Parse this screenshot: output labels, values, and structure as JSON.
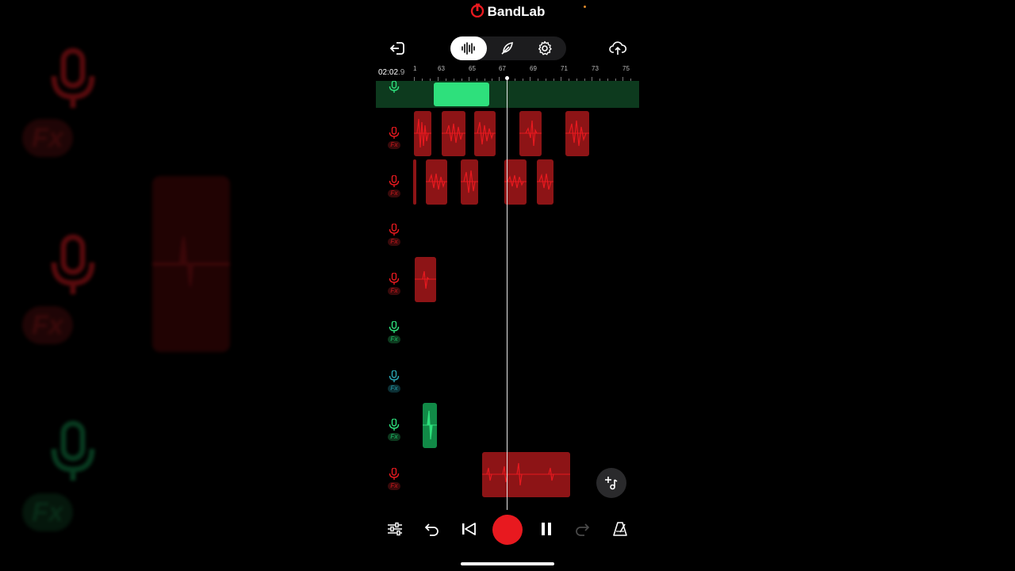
{
  "app": {
    "brand": "BandLab"
  },
  "colors": {
    "red": "#e8191f",
    "clip_red": "#8d1416",
    "green": "#2ee07c",
    "green_dark": "#0d3a1e",
    "cyan": "#2aa6b5"
  },
  "toolbar": {
    "back_icon": "exit-icon",
    "view_modes": [
      "waveform-icon",
      "feather-icon",
      "settings-gear-icon"
    ],
    "active_mode": "waveform-icon",
    "upload_icon": "cloud-upload-icon"
  },
  "timeline": {
    "timecode_main": "02:02",
    "timecode_frac": ".9",
    "ruler_labels": [
      "1",
      "63",
      "65",
      "67",
      "69",
      "71",
      "73",
      "75"
    ]
  },
  "tracks": [
    {
      "color": "green",
      "fx": false
    },
    {
      "color": "red",
      "fx": "Fx"
    },
    {
      "color": "red",
      "fx": "Fx"
    },
    {
      "color": "red",
      "fx": "Fx"
    },
    {
      "color": "red",
      "fx": "Fx"
    },
    {
      "color": "green",
      "fx": "Fx"
    },
    {
      "color": "cyan",
      "fx": "Fx"
    },
    {
      "color": "green",
      "fx": "Fx"
    },
    {
      "color": "red",
      "fx": "Fx"
    }
  ],
  "transport": {
    "icons": [
      "mixer-sliders-icon",
      "undo-icon",
      "skip-back-icon",
      "record-button",
      "pause-icon",
      "redo-icon",
      "metronome-icon"
    ]
  },
  "background_fx_label": "Fx"
}
